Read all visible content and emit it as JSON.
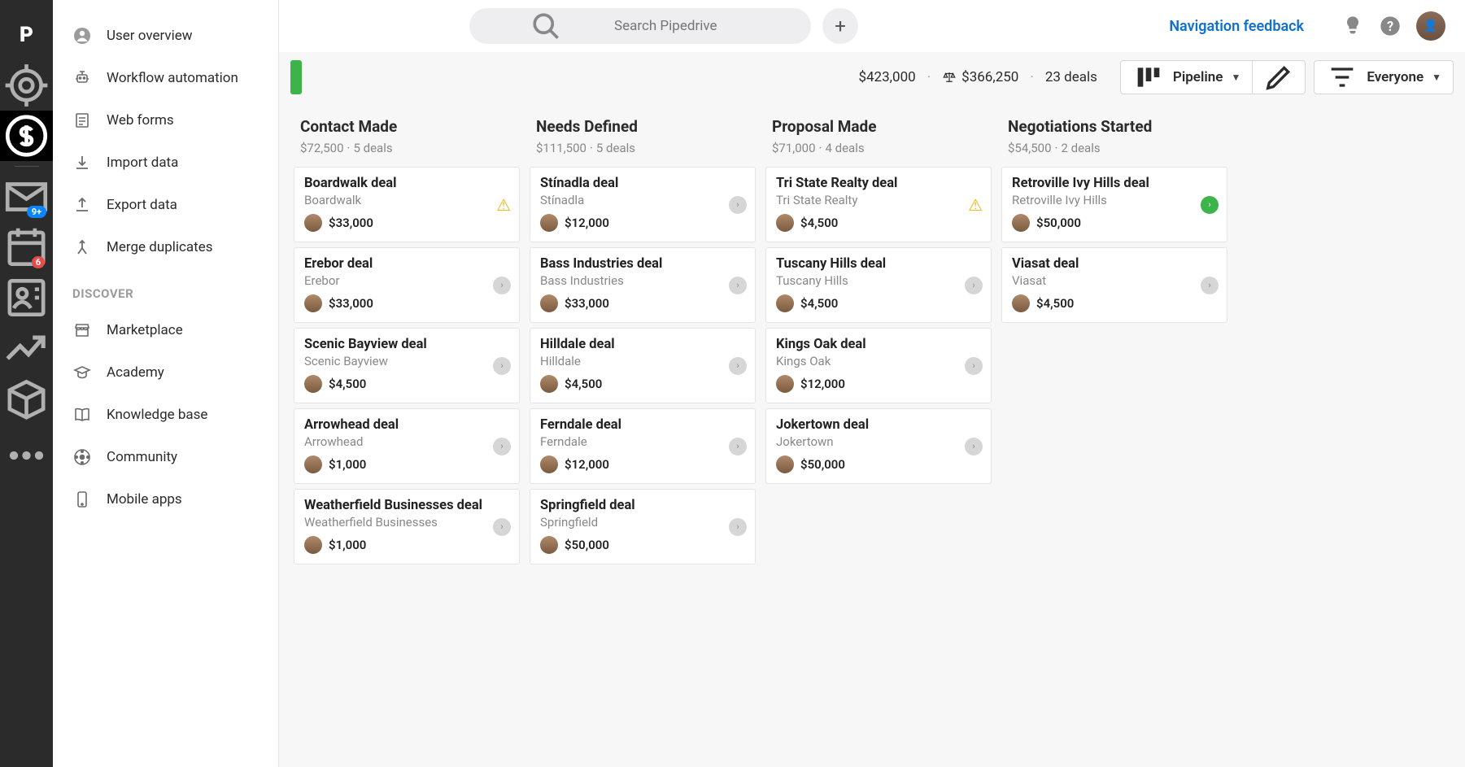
{
  "header": {
    "search_placeholder": "Search Pipedrive",
    "nav_feedback": "Navigation feedback"
  },
  "rail": {
    "mail_badge": "9+",
    "cal_badge": "6"
  },
  "sidemenu": {
    "items": [
      {
        "label": "User overview"
      },
      {
        "label": "Workflow automation"
      },
      {
        "label": "Web forms"
      },
      {
        "label": "Import data"
      },
      {
        "label": "Export data"
      },
      {
        "label": "Merge duplicates"
      }
    ],
    "discover_label": "DISCOVER",
    "discover_items": [
      {
        "label": "Marketplace"
      },
      {
        "label": "Academy"
      },
      {
        "label": "Knowledge base"
      },
      {
        "label": "Community"
      },
      {
        "label": "Mobile apps"
      }
    ]
  },
  "toolbar": {
    "total": "$423,000",
    "weighted": "$366,250",
    "deals": "23 deals",
    "pipeline_label": "Pipeline",
    "everyone_label": "Everyone"
  },
  "stages": [
    {
      "title": "Contact Made",
      "amount": "$72,500",
      "count": "5 deals",
      "cards": [
        {
          "title": "Boardwalk deal",
          "org": "Boardwalk",
          "value": "$33,000",
          "status": "warn"
        },
        {
          "title": "Erebor deal",
          "org": "Erebor",
          "value": "$33,000",
          "status": "gray"
        },
        {
          "title": "Scenic Bayview deal",
          "org": "Scenic Bayview",
          "value": "$4,500",
          "status": "gray"
        },
        {
          "title": "Arrowhead deal",
          "org": "Arrowhead",
          "value": "$1,000",
          "status": "gray"
        },
        {
          "title": "Weatherfield Businesses deal",
          "org": "Weatherfield Businesses",
          "value": "$1,000",
          "status": "gray"
        }
      ]
    },
    {
      "title": "Needs Defined",
      "amount": "$111,500",
      "count": "5 deals",
      "cards": [
        {
          "title": "Stínadla deal",
          "org": "Stínadla",
          "value": "$12,000",
          "status": "gray"
        },
        {
          "title": "Bass Industries deal",
          "org": "Bass Industries",
          "value": "$33,000",
          "status": "gray"
        },
        {
          "title": "Hilldale deal",
          "org": "Hilldale",
          "value": "$4,500",
          "status": "gray"
        },
        {
          "title": "Ferndale deal",
          "org": "Ferndale",
          "value": "$12,000",
          "status": "gray"
        },
        {
          "title": "Springfield deal",
          "org": "Springfield",
          "value": "$50,000",
          "status": "gray"
        }
      ]
    },
    {
      "title": "Proposal Made",
      "amount": "$71,000",
      "count": "4 deals",
      "cards": [
        {
          "title": "Tri State Realty deal",
          "org": "Tri State Realty",
          "value": "$4,500",
          "status": "warn"
        },
        {
          "title": "Tuscany Hills deal",
          "org": "Tuscany Hills",
          "value": "$4,500",
          "status": "gray"
        },
        {
          "title": "Kings Oak deal",
          "org": "Kings Oak",
          "value": "$12,000",
          "status": "gray"
        },
        {
          "title": "Jokertown deal",
          "org": "Jokertown",
          "value": "$50,000",
          "status": "gray"
        }
      ]
    },
    {
      "title": "Negotiations Started",
      "amount": "$54,500",
      "count": "2 deals",
      "cards": [
        {
          "title": "Retroville Ivy Hills deal",
          "org": "Retroville Ivy Hills",
          "value": "$50,000",
          "status": "green"
        },
        {
          "title": "Viasat deal",
          "org": "Viasat",
          "value": "$4,500",
          "status": "gray"
        }
      ]
    }
  ]
}
